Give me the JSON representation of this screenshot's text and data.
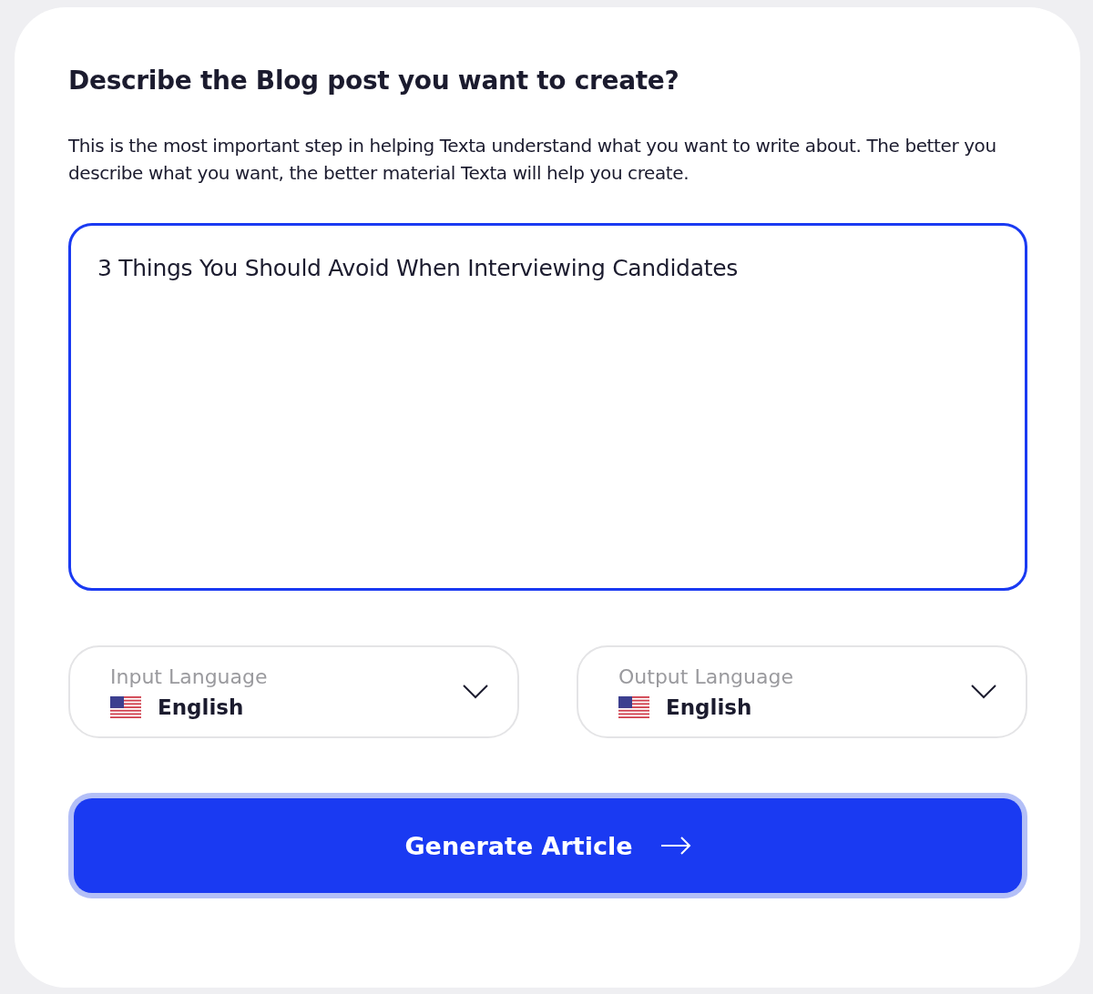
{
  "heading": "Describe the Blog post you want to create?",
  "intro": "This is the most important step in helping Texta understand what you want to write about. The better you describe what you want, the better material Texta will help you create.",
  "description": {
    "value": "3 Things You Should Avoid When Interviewing Candidates",
    "focused": true
  },
  "languages": [
    {
      "label": "Input Language",
      "value": "English"
    },
    {
      "label": "Output Language",
      "value": "English"
    }
  ],
  "generate_button": {
    "label": "Generate Article",
    "focused": true
  }
}
